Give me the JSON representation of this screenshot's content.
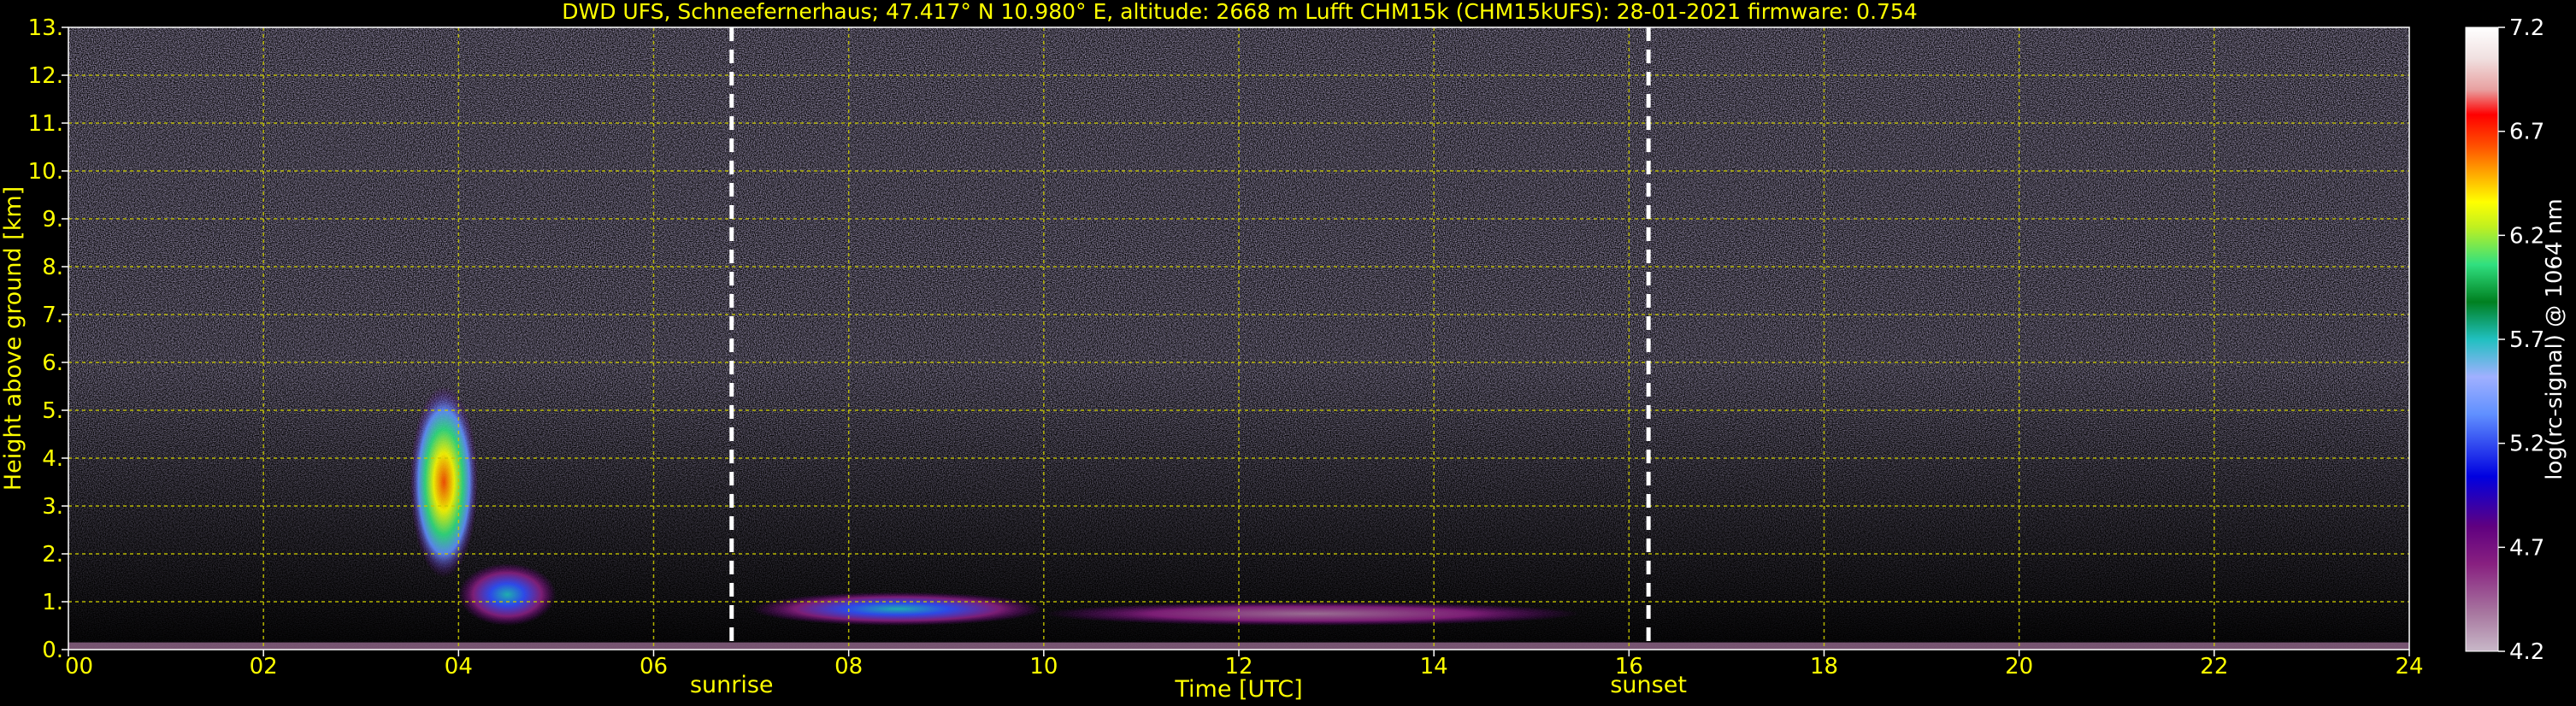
{
  "chart_data": {
    "type": "heatmap",
    "title": "DWD UFS, Schneefernerhaus; 47.417° N 10.980° E, altitude: 2668 m    Lufft CHM15k (CHM15kUFS): 28-01-2021    firmware: 0.754",
    "xlabel": "Time [UTC]",
    "ylabel": "Height above ground [km]",
    "xlim": [
      0,
      24
    ],
    "ylim": [
      0,
      13
    ],
    "x_ticks": [
      0,
      2,
      4,
      6,
      8,
      10,
      12,
      14,
      16,
      18,
      20,
      22,
      24
    ],
    "x_tick_labels": [
      "00",
      "02",
      "04",
      "06",
      "08",
      "10",
      "12",
      "14",
      "16",
      "18",
      "20",
      "22",
      "24"
    ],
    "y_ticks": [
      0,
      1,
      2,
      3,
      4,
      5,
      6,
      7,
      8,
      9,
      10,
      11,
      12,
      13
    ],
    "y_tick_labels": [
      "0.",
      "1.",
      "2.",
      "3.",
      "4.",
      "5.",
      "6.",
      "7.",
      "8.",
      "9.",
      "10.",
      "11.",
      "12.",
      "13."
    ],
    "grid": true,
    "vlines": [
      {
        "x": 6.8,
        "label": "sunrise"
      },
      {
        "x": 16.2,
        "label": "sunset"
      }
    ],
    "colorbar": {
      "label": "log(rc-signal) @ 1064 nm",
      "range": [
        4.2,
        7.2
      ],
      "ticks": [
        4.2,
        4.7,
        5.2,
        5.7,
        6.2,
        6.7,
        7.2
      ],
      "tick_labels": [
        "4.2",
        "4.7",
        "5.2",
        "5.7",
        "6.2",
        "6.7",
        "7.2"
      ]
    },
    "features": [
      {
        "t_start": 3.5,
        "t_end": 4.2,
        "h_bottom": 1.5,
        "h_top": 5.5,
        "max_value": 6.4
      },
      {
        "t_start": 4.0,
        "t_end": 5.0,
        "h_bottom": 0.5,
        "h_top": 1.8,
        "max_value": 5.6
      },
      {
        "t_start": 7.0,
        "t_end": 10.0,
        "h_bottom": 0.5,
        "h_top": 1.2,
        "max_value": 5.8
      },
      {
        "t_start": 10.0,
        "t_end": 15.5,
        "h_bottom": 0.5,
        "h_top": 1.0,
        "max_value": 4.9
      }
    ]
  }
}
